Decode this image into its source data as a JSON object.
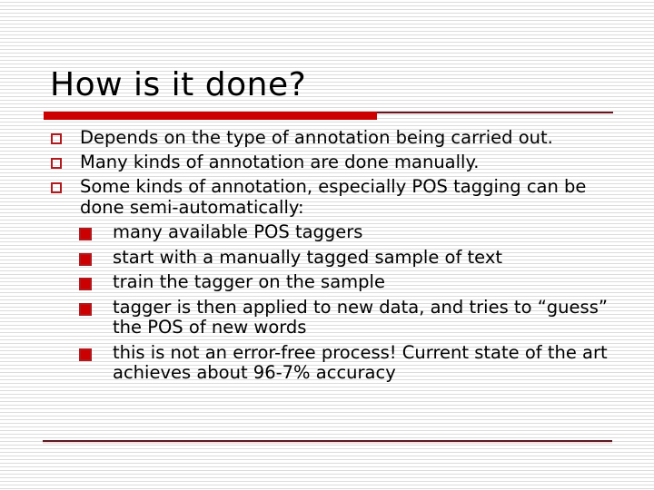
{
  "slide": {
    "title": "How is it done?",
    "bullets": [
      {
        "text": "Depends on the type of annotation being carried out."
      },
      {
        "text": "Many kinds of annotation are done manually."
      },
      {
        "text": "Some kinds of annotation, especially POS tagging can be done semi-automatically:",
        "sub_bullets": [
          "many available POS taggers",
          "start with a manually tagged sample of text",
          "train the tagger on the sample",
          "tagger is then applied to new data, and tries to “guess” the POS of new words",
          "this is not an error-free process! Current state of the art achieves about 96-7% accuracy"
        ]
      }
    ]
  },
  "colors": {
    "accent_red": "#cc0000",
    "bullet_outline": "#b0191d",
    "rule_dark": "#6a1420",
    "stripe": "#dcdcdc"
  },
  "icons": {
    "level1_bullet": "hollow-square-bullet-icon",
    "level2_bullet": "filled-square-bullet-icon"
  }
}
